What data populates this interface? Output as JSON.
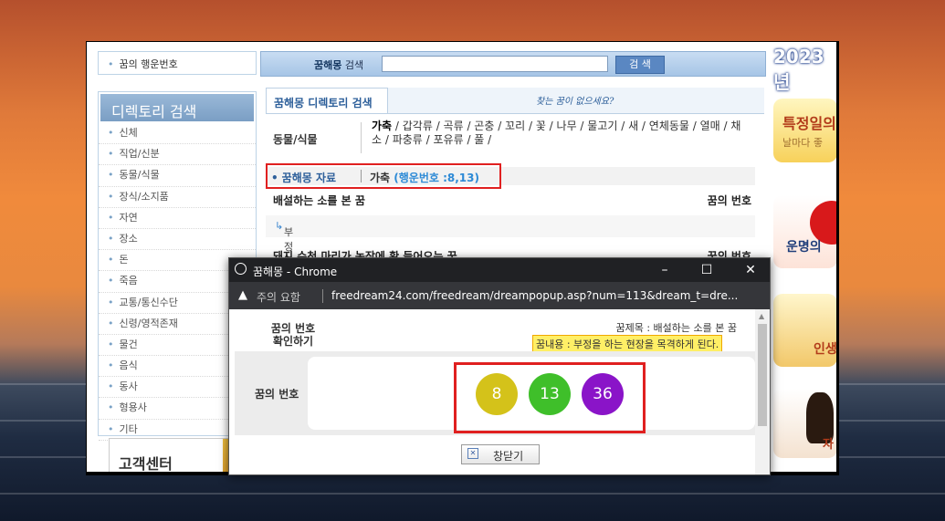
{
  "left": {
    "lucky_link": "꿈의 행운번호",
    "directory_title": "디렉토리 검색",
    "directory_items": [
      "신체",
      "직업/신분",
      "동물/식물",
      "장식/소지품",
      "자연",
      "장소",
      "돈",
      "죽음",
      "교통/통신수단",
      "신령/영적존재",
      "물건",
      "음식",
      "동사",
      "형용사",
      "기타"
    ],
    "customer_center": "고객센터"
  },
  "search": {
    "label_bold": "꿈해몽",
    "label": "검색",
    "button": "검 색"
  },
  "main": {
    "tab": "꿈해몽 디렉토리 검색",
    "hand_note": "찾는 꿈이 없으세요?",
    "category_name": "동물/식물",
    "category_first": "가축",
    "category_rest": " / 갑각류 / 곡류 / 곤충 / 꼬리 / 꽃 / 나무 / 물고기 / 새 / 연체동물 / 열매 / 채소 / 파충류 / 포유류 / 풀 /",
    "data_label": "꿈해몽 자료",
    "data_category": "가축",
    "data_lucky": "(행운번호 :8,13)",
    "dream1_title": "배설하는 소를 본 꿈",
    "number_header": "꿈의 번호",
    "dream1_desc": "부정을 하는 현장을 목격하게 된다.",
    "dream2_title": "돼지 수천 마리가 농장에 확 들어오는 꿈",
    "dream2_header": "꿈의 번호"
  },
  "ads": {
    "year": "2023년",
    "ad1_title": "특정일의",
    "ad1_sub": "날마다 좋",
    "ad2_title": "운명의",
    "ad3_title": "인생",
    "ad4_title": "자"
  },
  "popup": {
    "window_title": "꿈해몽 - Chrome",
    "warning": "주의 요함",
    "url": "freedream24.com/freedream/dreampopup.asp?num=113&dream_t=dre...",
    "check_label_line1": "꿈의 번호",
    "check_label_line2": "확인하기",
    "subject": "꿈제목 : 배설하는 소를 본 꿈",
    "content": "꿈내용 : 부정을 하는 현장을 목격하게 된다.",
    "numbers_label": "꿈의 번호",
    "numbers": [
      "8",
      "13",
      "36"
    ],
    "close_button": "창닫기",
    "colors": {
      "ball1": "#d4c21a",
      "ball2": "#3fbf2a",
      "ball3": "#8a14c8",
      "highlight": "#e02020"
    }
  }
}
